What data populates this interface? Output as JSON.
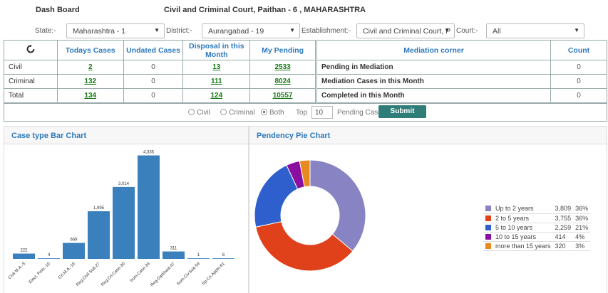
{
  "header": {
    "title": "Dash Board",
    "court": "Civil and Criminal Court, Paithan - 6 , MAHARASHTRA"
  },
  "filters": {
    "state_label": "State:-",
    "state_value": "Maharashtra - 1",
    "district_label": "District:-",
    "district_value": "Aurangabad - 19",
    "establishment_label": "Establishment:-",
    "establishment_value": "Civil and Criminal Court, P",
    "court_label": "Court:-",
    "court_value": "All"
  },
  "cases_table": {
    "refresh_icon": "refresh-icon",
    "headers": [
      "Todays Cases",
      "Undated Cases",
      "Disposal in this Month",
      "My Pending"
    ],
    "rows": [
      {
        "label": "Civil",
        "todays": "2",
        "undated": "0",
        "disposal": "13",
        "pending": "2533"
      },
      {
        "label": "Criminal",
        "todays": "132",
        "undated": "0",
        "disposal": "111",
        "pending": "8024"
      },
      {
        "label": "Total",
        "todays": "134",
        "undated": "0",
        "disposal": "124",
        "pending": "10557"
      }
    ]
  },
  "mediation": {
    "header": "Mediation corner",
    "count_header": "Count",
    "rows": [
      {
        "label": "Pending in Mediation",
        "count": "0"
      },
      {
        "label": "Mediation Cases in this Month",
        "count": "0"
      },
      {
        "label": "Completed in this Month",
        "count": "0"
      }
    ]
  },
  "options": {
    "civil": "Civil",
    "criminal": "Criminal",
    "both": "Both",
    "selected": "Both",
    "top_label": "Top",
    "top_value": "10",
    "pending_label": "Pending Cases",
    "submit": "Submit"
  },
  "bar_panel_title": "Case type Bar Chart",
  "pie_panel_title": "Pendency Pie Chart",
  "colors": {
    "bar": "#3a80bd",
    "accent_blue": "#2e79bd",
    "submit": "#2f7d78"
  },
  "chart_data": [
    {
      "type": "bar",
      "categories": [
        "Civil M.A.-3",
        "Elect. Petn.-10",
        "Cri.M.A.-19",
        "Reg.Civil Suit-27",
        "Reg.Cri.Case-30",
        "Sum.Case-34",
        "Reg.Darkhast-47",
        "Sum.Civ.Suit-59",
        "Sp.Cri.Appln-61"
      ],
      "values": [
        222,
        4,
        669,
        1995,
        3014,
        4335,
        311,
        1,
        6
      ],
      "data_labels": [
        "222",
        "4",
        "669",
        "1,995",
        "3,014",
        "4,335",
        "311",
        "1",
        "6"
      ],
      "ylim": [
        0,
        4500
      ]
    },
    {
      "type": "pie",
      "labels": [
        "Up to 2 years",
        "2 to 5 years",
        "5 to 10 years",
        "10 to 15 years",
        "more than 15 years"
      ],
      "values": [
        3809,
        3755,
        2259,
        414,
        320
      ],
      "value_labels": [
        "3,809",
        "3,755",
        "2,259",
        "414",
        "320"
      ],
      "percent_labels": [
        "36%",
        "36%",
        "21%",
        "4%",
        "3%"
      ],
      "colors": [
        "#8884c4",
        "#e0401a",
        "#2f5fcc",
        "#8a0fa0",
        "#e88a20"
      ],
      "donut": true
    }
  ]
}
